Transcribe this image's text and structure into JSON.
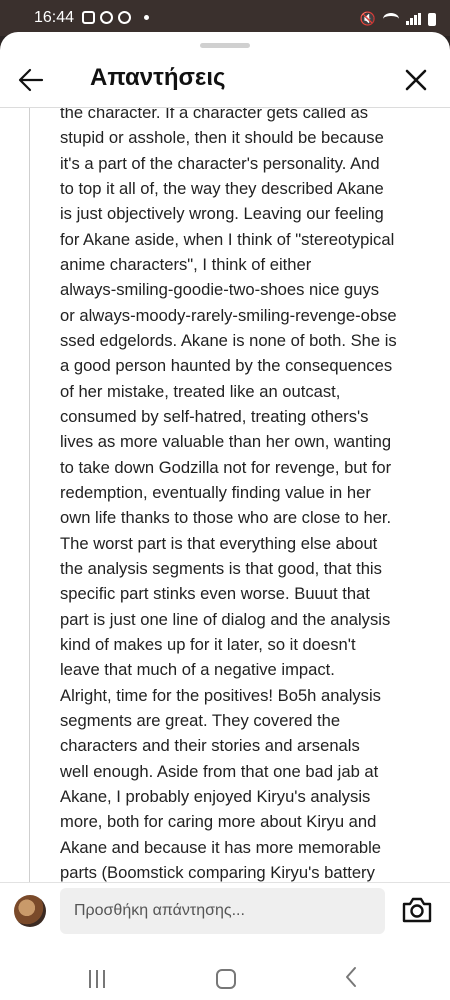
{
  "status_bar": {
    "time": "16:44",
    "left_icons": [
      "gallery-icon",
      "messenger-icon",
      "spotify-icon"
    ],
    "right_icons": [
      "mute-icon",
      "wifi-icon",
      "signal-icon",
      "battery-icon"
    ]
  },
  "header": {
    "title": "Απαντήσεις",
    "back_icon": "arrow-left-icon",
    "close_icon": "close-icon"
  },
  "reply": {
    "lines": [
      "the character. If a character gets called as",
      "stupid or asshole, then it should be because",
      "it's a part of the character's personality. And",
      "to top it all of, the way they described Akane",
      "is just objectively wrong. Leaving our feeling",
      "for Akane aside, when I think of \"stereotypical",
      "anime characters\", I think of either",
      "always-smiling-goodie-two-shoes nice guys",
      "or always-moody-rarely-smiling-revenge-obse",
      "ssed edgelords. Akane is none of both. She is",
      "a good person haunted by the consequences",
      "of her mistake, treated like an outcast,",
      "consumed by self-hatred, treating others's",
      "lives as more valuable than her own, wanting",
      "to take down Godzilla not for revenge, but for",
      "redemption, eventually finding value in her",
      "own life thanks to those who are close to her.",
      "The worst part is that everything else about",
      "the analysis segments is that good, that this",
      "specific part stinks even worse. Buuut that",
      "part is just one line of dialog and the analysis",
      "kind of makes up for it later, so it doesn't",
      "leave that much of a negative impact.",
      "Alright, time for the positives! Bo5h analysis",
      "segments are great. They covered the",
      "characters and their stories and arsenals",
      "well enough. Aside from that one bad jab at",
      "Akane, I probably enjoyed Kiryu's analysis",
      "more, both for caring more about Kiryu and",
      "Akane and because it has more memorable",
      "parts (Boomstick comparing Kiryu's battery"
    ]
  },
  "composer": {
    "placeholder": "Προσθήκη απάντησης...",
    "camera_icon": "camera-icon"
  },
  "navbar": {
    "icons": [
      "recents-icon",
      "home-icon",
      "back-icon"
    ]
  }
}
